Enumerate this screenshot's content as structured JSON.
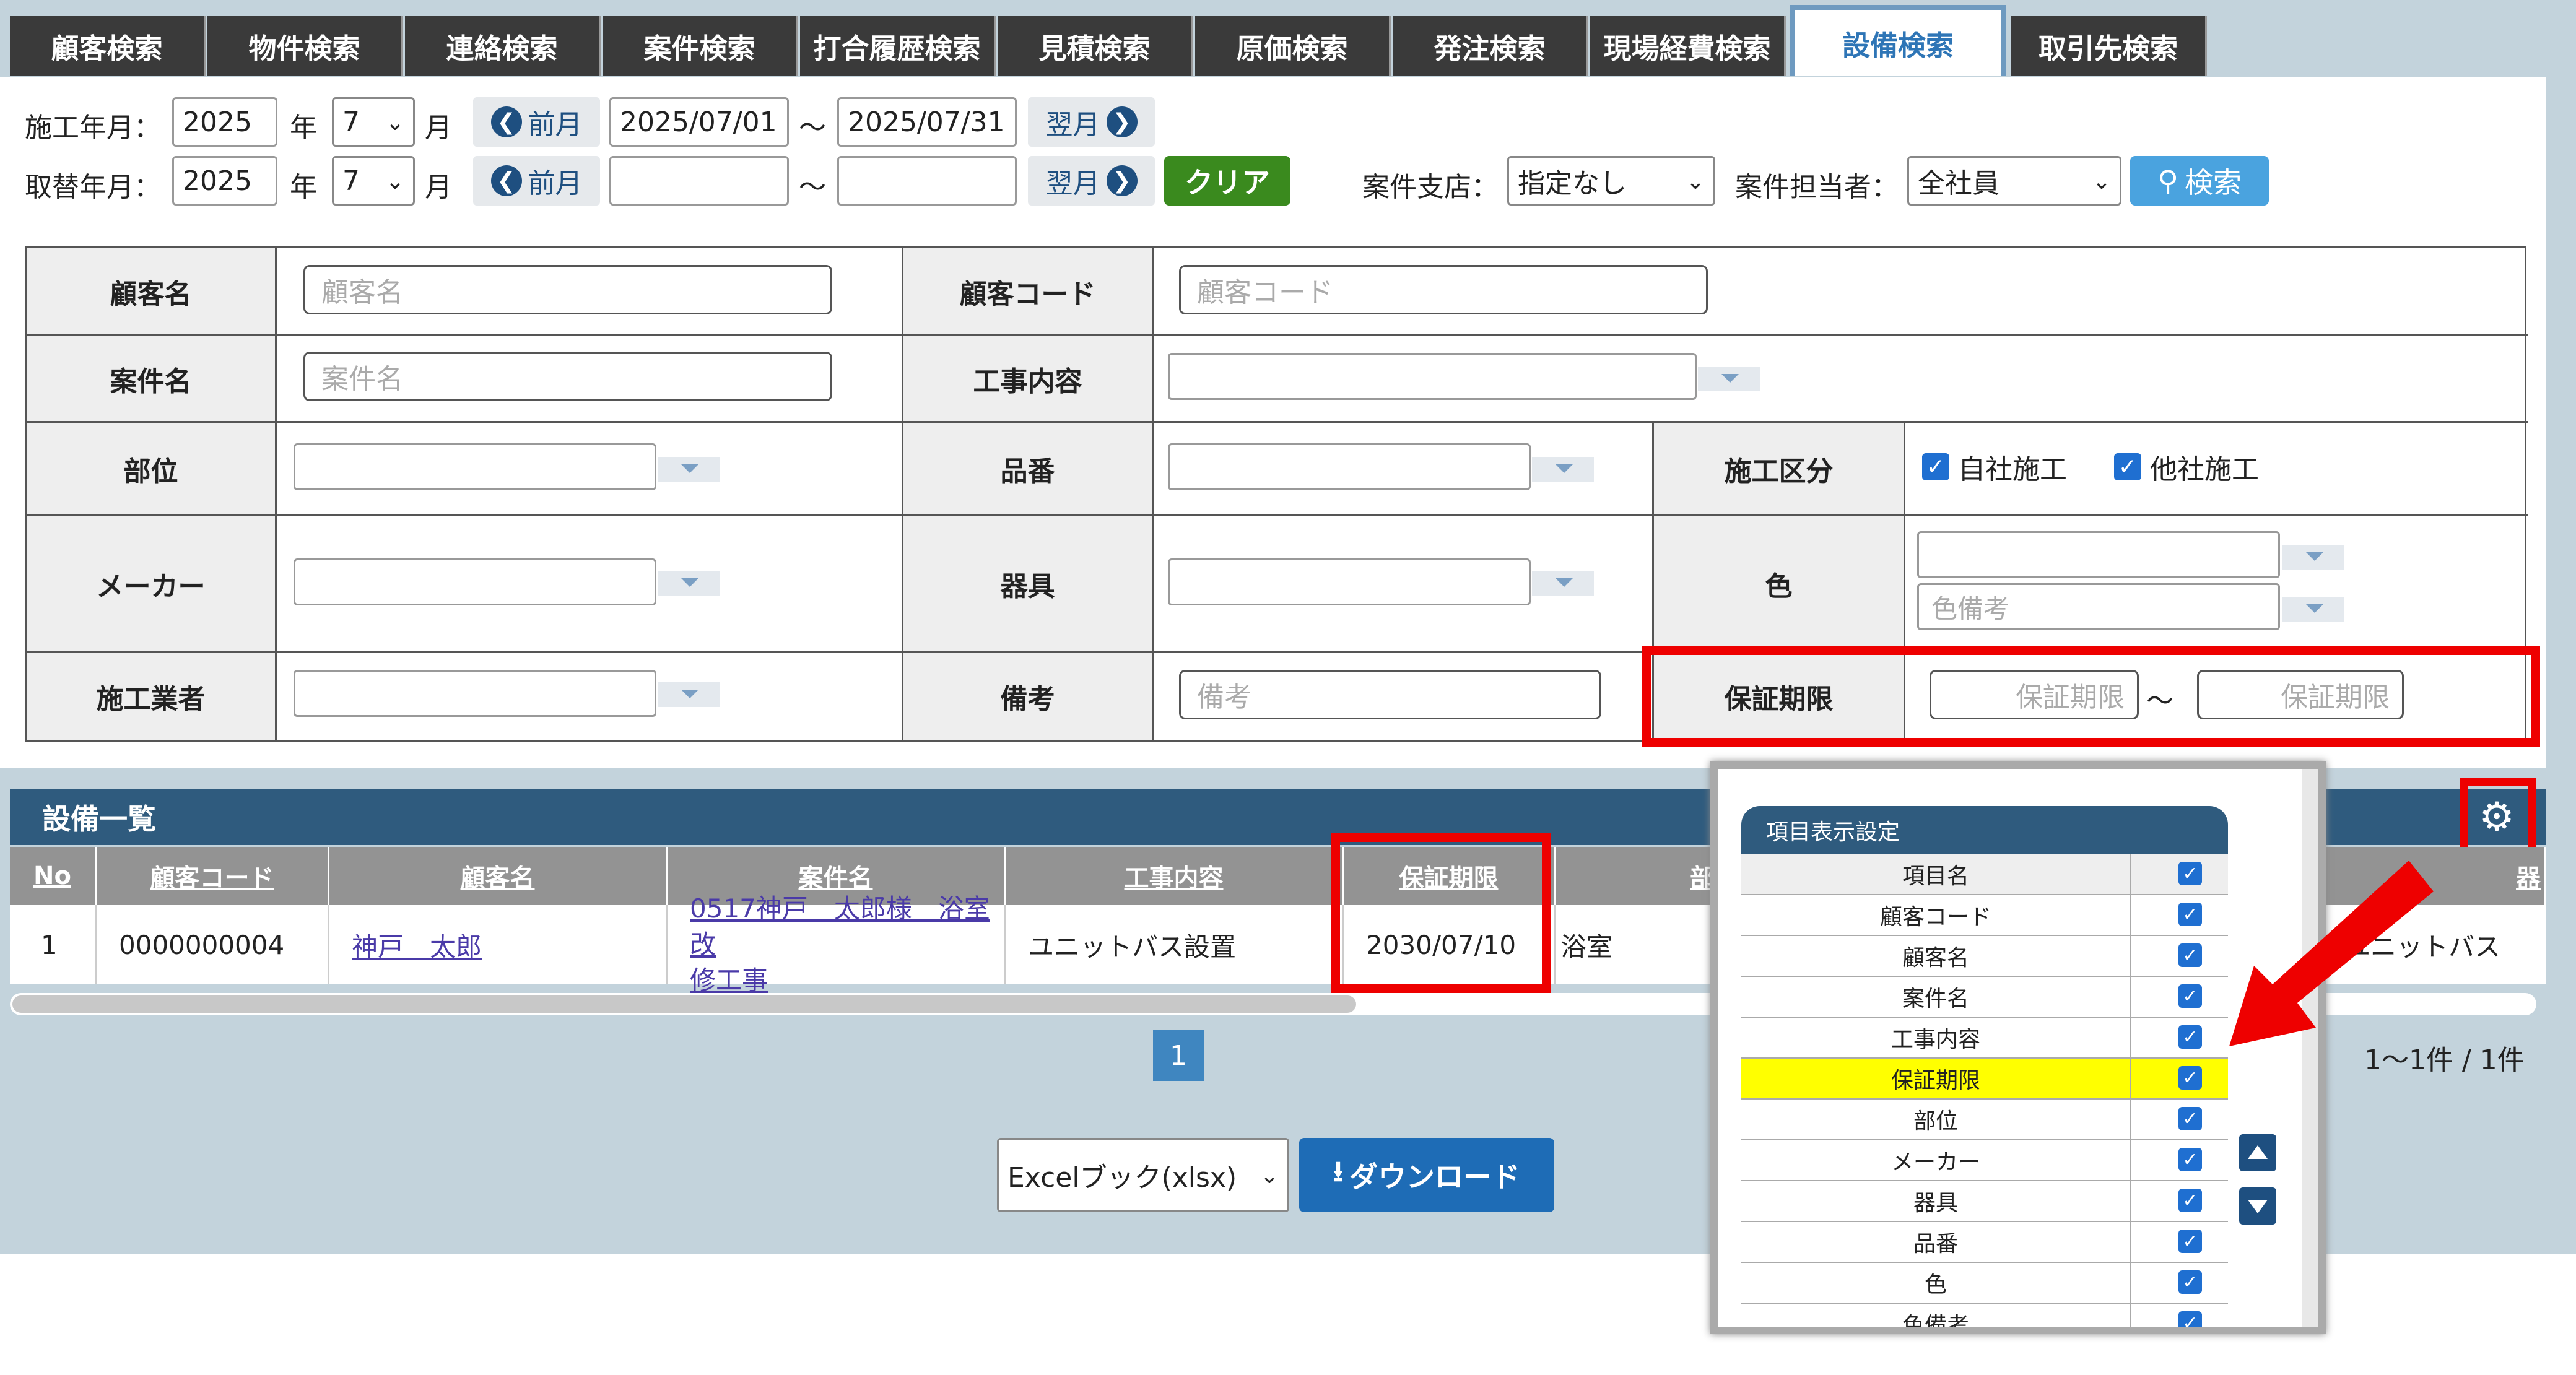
{
  "tabs": [
    "顧客検索",
    "物件検索",
    "連絡検索",
    "案件検索",
    "打合履歴検索",
    "見積検索",
    "原価検索",
    "発注検索",
    "現場経費検索",
    "設備検索",
    "取引先検索"
  ],
  "search": {
    "row1": {
      "label": "施工年月：",
      "year": "2025",
      "year_unit": "年",
      "month": "7",
      "month_unit": "月",
      "prev": "前月",
      "from": "2025/07/01",
      "tilde": "～",
      "to": "2025/07/31",
      "next": "翌月"
    },
    "row2": {
      "label": "取替年月：",
      "year": "2025",
      "year_unit": "年",
      "month": "7",
      "month_unit": "月",
      "prev": "前月",
      "from": "",
      "tilde": "～",
      "to": "",
      "next": "翌月"
    },
    "clear": "クリア",
    "branch_label": "案件支店：",
    "branch_value": "指定なし",
    "staff_label": "案件担当者：",
    "staff_value": "全社員",
    "search_btn": "検索"
  },
  "grid": {
    "customer_name": "顧客名",
    "customer_name_ph": "顧客名",
    "customer_code": "顧客コード",
    "customer_code_ph": "顧客コード",
    "project_name": "案件名",
    "project_name_ph": "案件名",
    "work": "工事内容",
    "part": "部位",
    "part_no": "品番",
    "division": "施工区分",
    "own": "自社施工",
    "other": "他社施工",
    "maker": "メーカー",
    "fixture": "器具",
    "color": "色",
    "color_note_ph": "色備考",
    "contractor": "施工業者",
    "note": "備考",
    "note_ph": "備考",
    "warranty": "保証期限",
    "warranty_ph": "保証期限",
    "tilde": "～"
  },
  "results": {
    "title": "設備一覧",
    "headers": [
      "No",
      "顧客コード",
      "顧客名",
      "案件名",
      "工事内容",
      "保証期限",
      "部",
      "器"
    ],
    "row": {
      "no": "1",
      "code": "0000000004",
      "name": "神戸　太郎",
      "project1": "0517神戸　太郎様　浴室改",
      "project2": "修工事",
      "work": "ユニットバス設置",
      "warranty": "2030/07/10",
      "part": "浴室",
      "fixture": "ユニットバス"
    },
    "page": "1",
    "count": "1～1件 / 1件",
    "format": "Excelブック(xlsx)",
    "download": "ダウンロード"
  },
  "popup": {
    "title": "項目表示設定",
    "items": [
      "項目名",
      "顧客コード",
      "顧客名",
      "案件名",
      "工事内容",
      "保証期限",
      "部位",
      "メーカー",
      "器具",
      "品番",
      "色",
      "色備考"
    ],
    "highlight": "保証期限"
  },
  "colors": {
    "accent": "#2f5b7e",
    "red": "#ee0000",
    "green": "#3a8a1e",
    "blue": "#4aa3df",
    "highlight": "#ffff00"
  }
}
